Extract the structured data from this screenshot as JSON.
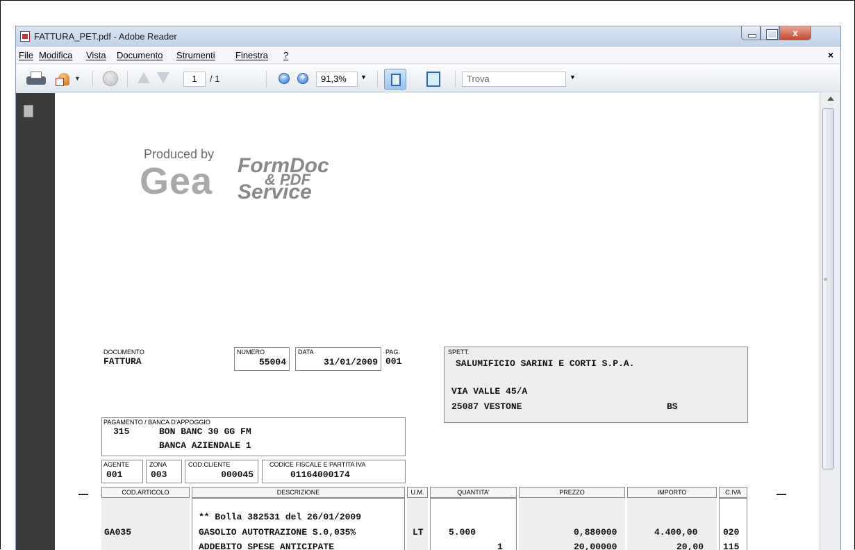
{
  "window": {
    "title": "FATTURA_PET.pdf - Adobe Reader",
    "close_glyph": "x"
  },
  "menu": {
    "items": [
      "File",
      "Modifica",
      "Vista",
      "Documento",
      "Strumenti",
      "Finestra",
      "?"
    ],
    "close_glyph": "×"
  },
  "toolbar": {
    "page_current": "1",
    "page_total": "/ 1",
    "zoom": "91,3%",
    "find_placeholder": "Trova",
    "dropdown_glyph": "▼"
  },
  "icons": [
    "print-icon",
    "collaborate-icon",
    "globe-icon",
    "previous-page-icon",
    "next-page-icon",
    "zoom-out-icon",
    "zoom-in-icon",
    "fit-width-icon",
    "fit-page-icon",
    "pages-panel-icon"
  ],
  "logo": {
    "produced_by": "Produced by",
    "gea": "Gea",
    "formdoc": "FormDoc",
    "pdf": "& PDF",
    "service": "Service"
  },
  "invoice": {
    "documento_label": "DOCUMENTO",
    "documento": "FATTURA",
    "numero_label": "NUMERO",
    "numero": "55004",
    "data_label": "DATA",
    "data": "31/01/2009",
    "pag_label": "PAG.",
    "pag": "001",
    "spett_label": "SPETT.",
    "spett_name": "SALUMIFICIO SARINI E CORTI S.P.A.",
    "spett_address": "VIA VALLE 45/A",
    "spett_city": "25087 VESTONE",
    "spett_prov": "BS",
    "pagamento_label": "PAGAMENTO / BANCA D'APPOGGIO",
    "pagamento_code": "315",
    "pagamento_desc": "BON BANC 30 GG FM",
    "banca": "BANCA AZIENDALE 1",
    "agente_label": "AGENTE",
    "agente": "001",
    "zona_label": "ZONA",
    "zona": "003",
    "codcliente_label": "COD.CLIENTE",
    "codcliente": "000045",
    "cf_label": "CODICE FISCALE E PARTITA IVA",
    "cf": "01164000174"
  },
  "table": {
    "headers": [
      "COD.ARTICOLO",
      "DESCRIZIONE",
      "U.M.",
      "QUANTITA'",
      "PREZZO",
      "IMPORTO",
      "C.IVA"
    ],
    "note": "** Bolla 382531 del 26/01/2009",
    "rows": [
      {
        "cod": "GA035",
        "desc": "GASOLIO AUTOTRAZIONE S.0,035%",
        "um": "LT",
        "qta": "5.000",
        "prezzo": "0,880000",
        "importo": "4.400,00",
        "iva": "020"
      },
      {
        "cod": "",
        "desc": "ADDEBITO SPESE ANTICIPATE",
        "um": "",
        "qta": "1",
        "prezzo": "20,00000",
        "importo": "20,00",
        "iva": "115"
      }
    ]
  }
}
